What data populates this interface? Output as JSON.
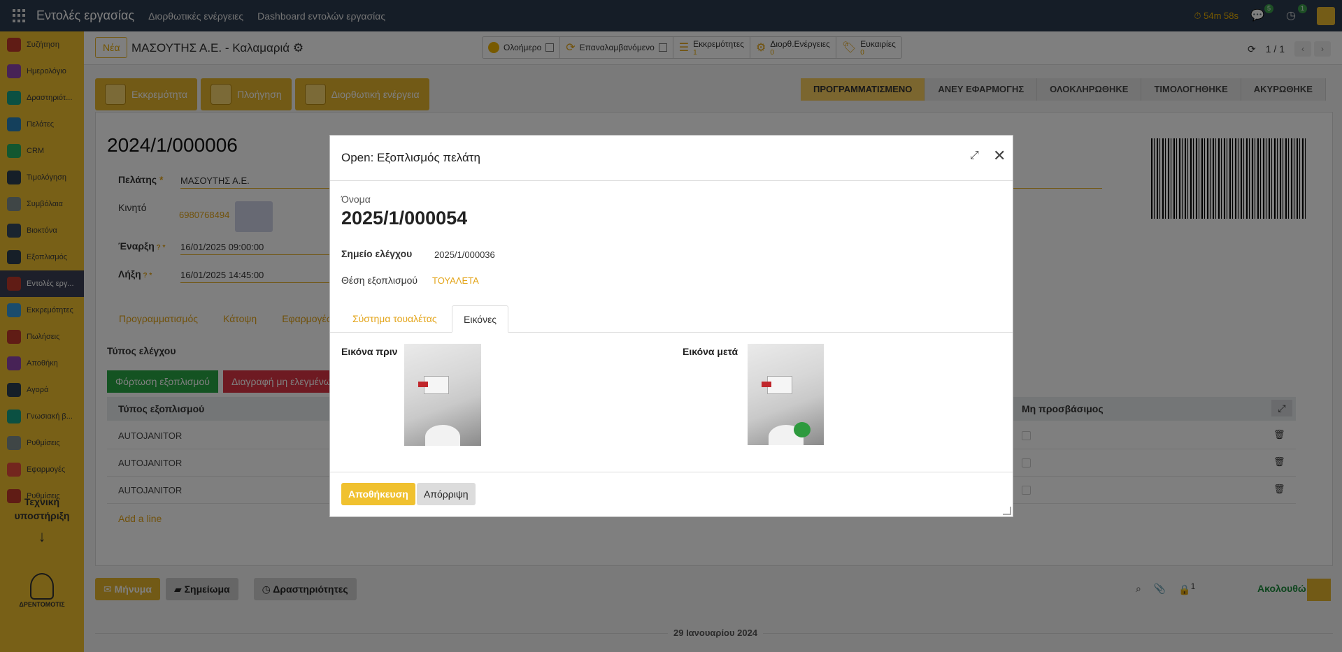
{
  "topbar": {
    "app_title": "Εντολές εργασίας",
    "menu": [
      "Διορθωτικές ενέργειες",
      "Dashboard εντολών εργασίας"
    ],
    "timer": "54m 58s",
    "messages_count": "5",
    "activities_count": "1"
  },
  "sidebar": {
    "items": [
      {
        "label": "Συζήτηση",
        "color": "#c0392b"
      },
      {
        "label": "Ημερολόγιο",
        "color": "#8e44ad"
      },
      {
        "label": "Δραστηριότ...",
        "color": "#16a085"
      },
      {
        "label": "Πελάτες",
        "color": "#2980b9"
      },
      {
        "label": "CRM",
        "color": "#27ae60"
      },
      {
        "label": "Τιμολόγηση",
        "color": "#2c3e50"
      },
      {
        "label": "Συμβόλαια",
        "color": "#7f8c8d"
      },
      {
        "label": "Βιοκτόνα",
        "color": "#34495e"
      },
      {
        "label": "Εξοπλισμός",
        "color": "#2c3e50"
      },
      {
        "label": "Εντολές εργ...",
        "color": "#c0392b"
      },
      {
        "label": "Εκκρεμότητες",
        "color": "#3498db"
      },
      {
        "label": "Πωλήσεις",
        "color": "#c0392b"
      },
      {
        "label": "Αποθήκη",
        "color": "#8e44ad"
      },
      {
        "label": "Αγορά",
        "color": "#2c3e50"
      },
      {
        "label": "Γνωσιακή β...",
        "color": "#16a085"
      },
      {
        "label": "Ρυθμίσεις",
        "color": "#7f8c8d"
      },
      {
        "label": "Εφαρμογές",
        "color": "#e74c3c"
      },
      {
        "label": "Ρυθμίσεις",
        "color": "#c0392b"
      }
    ],
    "active_index": 9,
    "support_line1": "Τεχνική",
    "support_line2": "υποστήριξη",
    "support_arrow": "↓",
    "logo_text": "ΔΡΕΝΤΟΜΟΤΙΣ"
  },
  "control": {
    "new_label": "Νέα",
    "breadcrumb": "ΜΑΣΟΥΤΗΣ Α.Ε. - Καλαμαριά",
    "filters": [
      {
        "label": "Ολοήμερο"
      },
      {
        "label": "Επαναλαμβανόμενο"
      },
      {
        "label": "Εκκρεμότητες",
        "sub": "1"
      },
      {
        "label": "Διορθ.Ενέργειες",
        "sub": "0"
      },
      {
        "label": "Ευκαιρίες",
        "sub": "0"
      }
    ],
    "pager": "1 / 1"
  },
  "actions": [
    "Εκκρεμότητα",
    "Πλοήγηση",
    "Διορθωτική ενέργεια"
  ],
  "statuses": [
    "ΠΡΟΓΡΑΜΜΑΤΙΣΜΕΝΟ",
    "ΑΝΕΥ ΕΦΑΡΜΟΓΗΣ",
    "ΟΛΟΚΛΗΡΩΘΗΚΕ",
    "ΤΙΜΟΛΟΓΗΘΗΚΕ",
    "ΑΚΥΡΩΘΗΚΕ"
  ],
  "record": {
    "title": "2024/1/000006",
    "customer_label": "Πελάτης",
    "customer_value": "ΜΑΣΟΥΤΗΣ Α.Ε.",
    "mobile_label": "Κινητό",
    "mobile_value": "6980768494",
    "start_label": "Έναρξη",
    "start_value": "16/01/2025 09:00:00",
    "end_label": "Λήξη",
    "end_value": "16/01/2025 14:45:00",
    "tabs": [
      "Προγραμματισμός",
      "Κάτοψη",
      "Εφαρμογές"
    ],
    "section_title": "Τύπος ελέγχου",
    "load_btn": "Φόρτωση εξοπλισμού",
    "delete_btn": "Διαγραφή μη ελεγμένων",
    "col_type": "Τύπος εξοπλισμού",
    "col_inaccessible": "Μη προσβάσιμος",
    "rows": [
      "AUTOJANITOR",
      "AUTOJANITOR",
      "AUTOJANITOR"
    ],
    "add_line": "Add a line"
  },
  "chatter": {
    "message": "Μήνυμα",
    "note": "Σημείωμα",
    "activities": "Δραστηριότητες",
    "followers_count": "1",
    "follow": "Ακολουθώ",
    "date_separator": "29 Ιανουαρίου 2024"
  },
  "modal": {
    "title": "Open: Εξοπλισμός πελάτη",
    "name_label": "Όνομα",
    "name_value": "2025/1/000054",
    "checkpoint_label": "Σημείο ελέγχου",
    "checkpoint_value": "2025/1/000036",
    "position_label": "Θέση εξοπλισμού",
    "position_value": "ΤΟΥΑΛΕΤΑ",
    "tabs": [
      "Σύστημα τουαλέτας",
      "Εικόνες"
    ],
    "active_tab": 1,
    "image_before_label": "Εικόνα πριν",
    "image_after_label": "Εικόνα μετά",
    "save_label": "Αποθήκευση",
    "discard_label": "Απόρριψη"
  }
}
